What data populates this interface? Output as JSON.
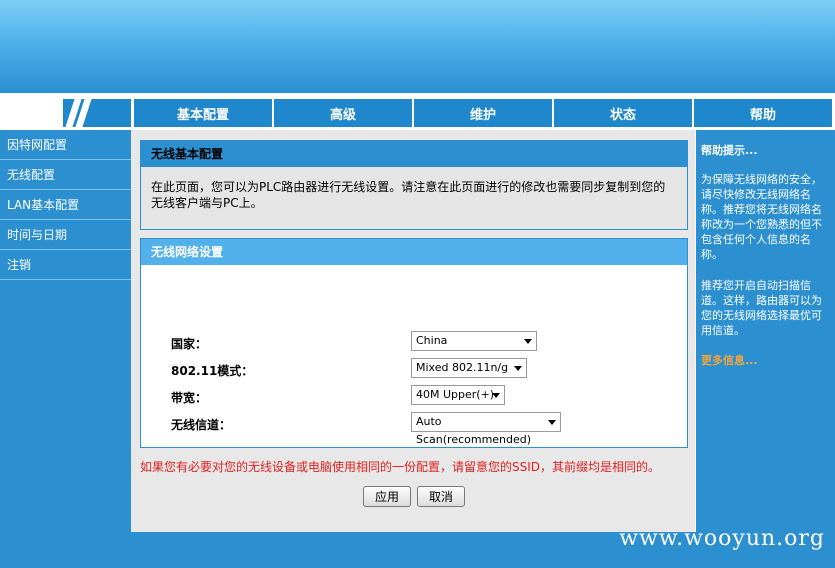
{
  "nav": {
    "tabs": [
      "基本配置",
      "高级",
      "维护",
      "状态",
      "帮助"
    ]
  },
  "sidebar": {
    "items": [
      "因特网配置",
      "无线配置",
      "LAN基本配置",
      "时间与日期",
      "注销"
    ]
  },
  "panel1": {
    "title": "无线基本配置",
    "text": "在此页面，您可以为PLC路由器进行无线设置。请注意在此页面进行的修改也需要同步复制到您的无线客户端与PC上。"
  },
  "panel2": {
    "title": "无线网络设置",
    "fields": [
      {
        "label": "国家：",
        "value": "China"
      },
      {
        "label": "802.11模式：",
        "value": "Mixed 802.11n/g"
      },
      {
        "label": "带宽：",
        "value": "40M Upper(+)"
      },
      {
        "label": "无线信道：",
        "value": "Auto Scan(recommended)"
      }
    ]
  },
  "warning": "如果您有必要对您的无线设备或电脑使用相同的一份配置，请留意您的SSID，其前缀均是相同的。",
  "buttons": {
    "apply": "应用",
    "cancel": "取消"
  },
  "help": {
    "title": "帮助提示...",
    "p1": "为保障无线网络的安全，请尽快修改无线网络名称。推荐您将无线网络名称改为一个您熟悉的但不包含任何个人信息的名称。",
    "p2": "推荐您开启自动扫描信道。这样，路由器可以为您的无线网络选择最优可用信道。",
    "more": "更多信息..."
  },
  "watermark": "www.wooyun.org",
  "colors": {
    "primary": "#2b8fd0",
    "header_light": "#52b0ea",
    "warning": "#e02020",
    "more_link": "#f5a53a"
  }
}
